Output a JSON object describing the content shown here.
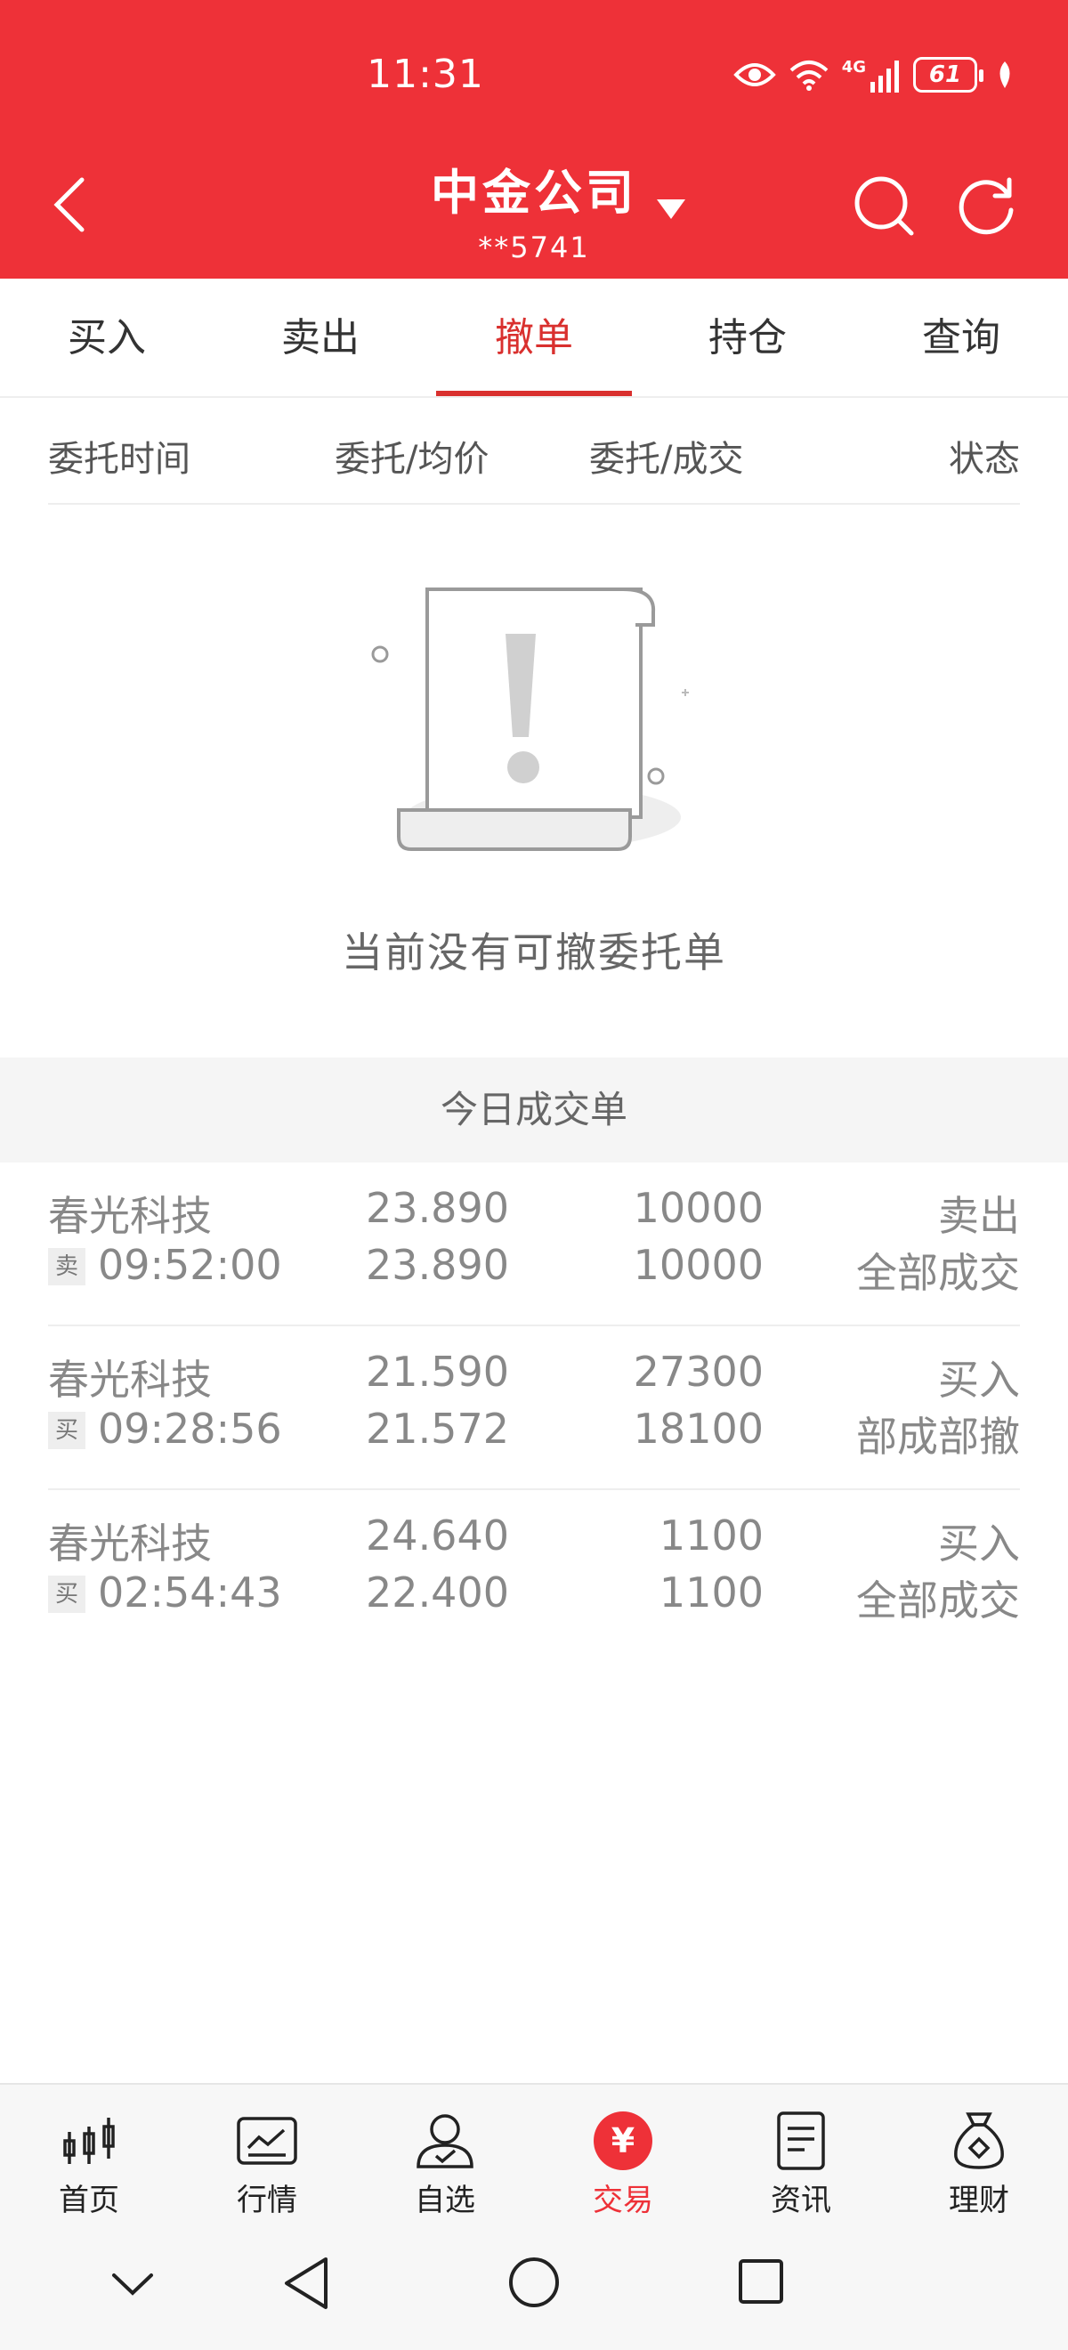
{
  "status_bar": {
    "time": "11:31",
    "battery": "61",
    "network": "4G"
  },
  "header": {
    "title": "中金公司",
    "account": "**5741"
  },
  "tabs": [
    {
      "label": "买入"
    },
    {
      "label": "卖出"
    },
    {
      "label": "撤单",
      "active": true
    },
    {
      "label": "持仓"
    },
    {
      "label": "查询"
    }
  ],
  "columns": {
    "time": "委托时间",
    "price": "委托/均价",
    "qty": "委托/成交",
    "status": "状态"
  },
  "empty_state": {
    "text": "当前没有可撤委托单"
  },
  "section_title": "今日成交单",
  "deals": [
    {
      "name": "春光科技",
      "side_badge": "卖",
      "time": "09:52:00",
      "price_order": "23.890",
      "price_avg": "23.890",
      "qty_order": "10000",
      "qty_filled": "10000",
      "direction": "卖出",
      "status": "全部成交"
    },
    {
      "name": "春光科技",
      "side_badge": "买",
      "time": "09:28:56",
      "price_order": "21.590",
      "price_avg": "21.572",
      "qty_order": "27300",
      "qty_filled": "18100",
      "direction": "买入",
      "status": "部成部撤"
    },
    {
      "name": "春光科技",
      "side_badge": "买",
      "time": "02:54:43",
      "price_order": "24.640",
      "price_avg": "22.400",
      "qty_order": "1100",
      "qty_filled": "1100",
      "direction": "买入",
      "status": "全部成交"
    }
  ],
  "bottom_nav": [
    {
      "label": "首页",
      "icon": "candlestick-icon"
    },
    {
      "label": "行情",
      "icon": "chart-icon"
    },
    {
      "label": "自选",
      "icon": "user-check-icon"
    },
    {
      "label": "交易",
      "icon": "yen-icon",
      "active": true
    },
    {
      "label": "资讯",
      "icon": "document-icon"
    },
    {
      "label": "理财",
      "icon": "money-bag-icon"
    }
  ],
  "colors": {
    "brand_red": "#ee3138",
    "active_tab": "#d9302e",
    "text_gray": "#888888"
  },
  "labels": {
    "currency_symbol": "¥"
  }
}
